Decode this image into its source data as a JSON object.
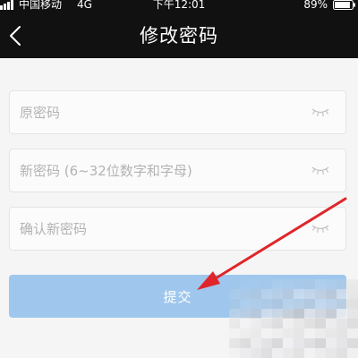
{
  "status_bar": {
    "carrier": "中国移动",
    "network": "4G",
    "time": "下午12:01",
    "battery_percent": "89%",
    "battery_level": 89,
    "signal_bars": 4
  },
  "nav_bar": {
    "back_icon": "chevron-left-icon",
    "title": "修改密码"
  },
  "form": {
    "fields": [
      {
        "placeholder": "原密码",
        "value": "",
        "icon": "eye-closed-icon"
      },
      {
        "placeholder": "新密码 (6~32位数字和字母)",
        "value": "",
        "icon": "eye-closed-icon"
      },
      {
        "placeholder": "确认新密码",
        "value": "",
        "icon": "eye-closed-icon"
      }
    ],
    "submit_label": "提交"
  },
  "colors": {
    "header_bg": "#111111",
    "page_bg": "#f5f5f5",
    "submit_bg": "#9fc7ed",
    "annotation_arrow": "#e0262a"
  }
}
